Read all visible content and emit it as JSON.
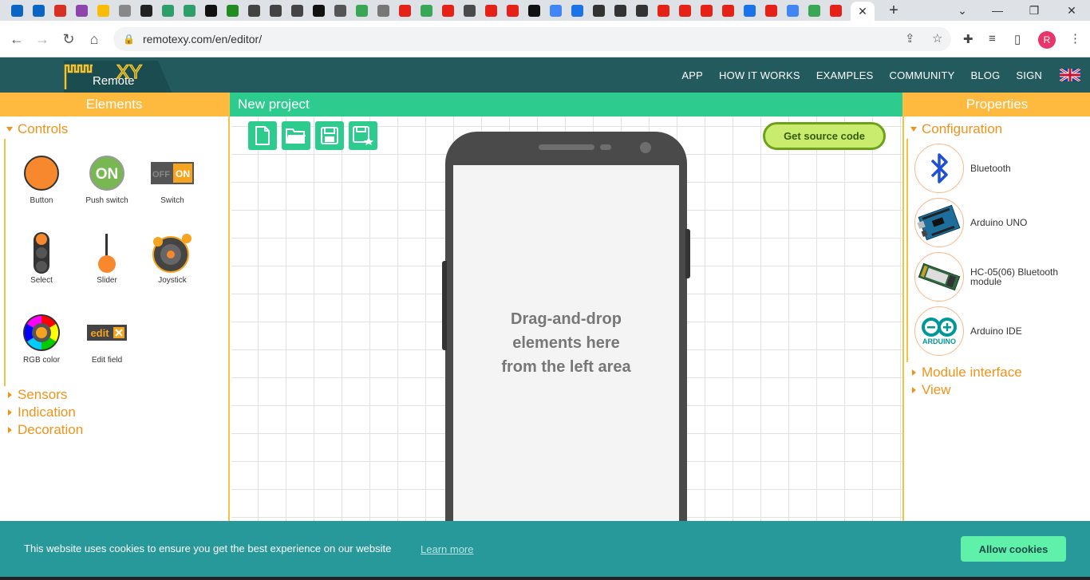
{
  "browser": {
    "active_tab_close": "✕",
    "new_tab": "+",
    "url": "remotexy.com/en/editor/",
    "profile_initial": "R",
    "favicon_colors": [
      "#0a66c2",
      "#0a66c2",
      "#d93025",
      "#8e44ad",
      "#fbbc05",
      "#888888",
      "#222222",
      "#2e9e6b",
      "#2e9e6b",
      "#111111",
      "#228b22",
      "#444444",
      "#444444",
      "#444444",
      "#111111",
      "#555555",
      "#3aa757",
      "#777777",
      "#e62117",
      "#3aa757",
      "#e62117",
      "#4a4a4a",
      "#e62117",
      "#e62117",
      "#111111",
      "#4285f4",
      "#1a73e8",
      "#333333",
      "#333333",
      "#333333",
      "#e62117",
      "#e62117",
      "#e62117",
      "#e62117",
      "#1a73e8",
      "#e62117",
      "#4285f4",
      "#3aa757",
      "#e62117"
    ]
  },
  "site": {
    "logo_text": "Remote",
    "logo_xy": "XY",
    "menu": [
      "APP",
      "HOW IT WORKS",
      "EXAMPLES",
      "COMMUNITY",
      "BLOG",
      "SIGN"
    ]
  },
  "left_panel": {
    "title": "Elements",
    "controls_label": "Controls",
    "elements": [
      {
        "label": "Button"
      },
      {
        "label": "Push switch",
        "icon_text": "ON"
      },
      {
        "label": "Switch",
        "off_text": "OFF",
        "on_text": "ON"
      },
      {
        "label": "Select"
      },
      {
        "label": "Slider"
      },
      {
        "label": "Joystick"
      },
      {
        "label": "RGB color"
      },
      {
        "label": "Edit field",
        "icon_text": "edit"
      }
    ],
    "sections": [
      "Sensors",
      "Indication",
      "Decoration"
    ]
  },
  "center": {
    "title": "New project",
    "source_button": "Get source code",
    "drop_line1": "Drag-and-drop",
    "drop_line2": "elements here",
    "drop_line3": "from the left area"
  },
  "right_panel": {
    "title": "Properties",
    "configuration_label": "Configuration",
    "items": [
      {
        "label": "Bluetooth"
      },
      {
        "label": "Arduino UNO"
      },
      {
        "label": "HC-05(06) Bluetooth module"
      },
      {
        "label": "Arduino IDE",
        "logo_text": "ARDUINO"
      }
    ],
    "sections": [
      "Module interface",
      "View"
    ]
  },
  "cookie": {
    "message": "This website uses cookies to ensure you get the best experience on our website",
    "link": "Learn more",
    "button": "Allow cookies"
  },
  "colors": {
    "header": "#235a5e",
    "panel_head": "#fdba3f",
    "accent_orange": "#f0931b",
    "green": "#2ecb8e",
    "cookie_bg": "#27999a"
  }
}
